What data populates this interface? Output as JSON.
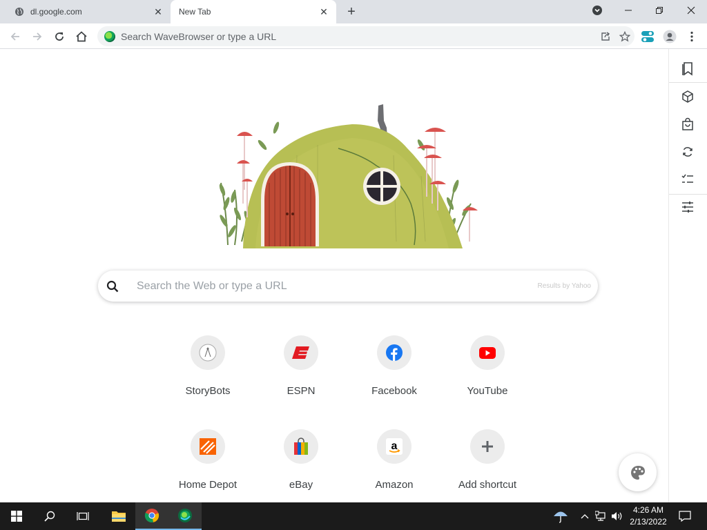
{
  "tabs": [
    {
      "title": "dl.google.com",
      "favicon": "globe-icon",
      "active": false
    },
    {
      "title": "New Tab",
      "favicon": "",
      "active": true
    }
  ],
  "toolbar": {
    "omnibox_placeholder": "Search WaveBrowser or type a URL"
  },
  "search": {
    "placeholder": "Search the Web or type a URL",
    "powered_by": "Results by Yahoo"
  },
  "shortcuts": [
    {
      "label": "StoryBots",
      "icon": "storybots-icon"
    },
    {
      "label": "ESPN",
      "icon": "espn-icon"
    },
    {
      "label": "Facebook",
      "icon": "facebook-icon"
    },
    {
      "label": "YouTube",
      "icon": "youtube-icon"
    },
    {
      "label": "Home Depot",
      "icon": "homedepot-icon"
    },
    {
      "label": "eBay",
      "icon": "ebay-icon"
    },
    {
      "label": "Amazon",
      "icon": "amazon-icon"
    },
    {
      "label": "Add shortcut",
      "icon": "plus-icon"
    }
  ],
  "sidebar": [
    "bookmarks-icon",
    "cube-icon",
    "shopping-bag-icon",
    "sync-icon",
    "checklist-icon",
    "sliders-icon"
  ],
  "taskbar": {
    "time": "4:26 AM",
    "date": "2/13/2022"
  },
  "colors": {
    "tabstrip_bg": "#dee1e6",
    "taskbar_bg": "#1b1b1b",
    "espn_red": "#e21b22",
    "facebook_blue": "#1877f2",
    "youtube_red": "#ff0000",
    "homedepot_orange": "#f96302"
  }
}
